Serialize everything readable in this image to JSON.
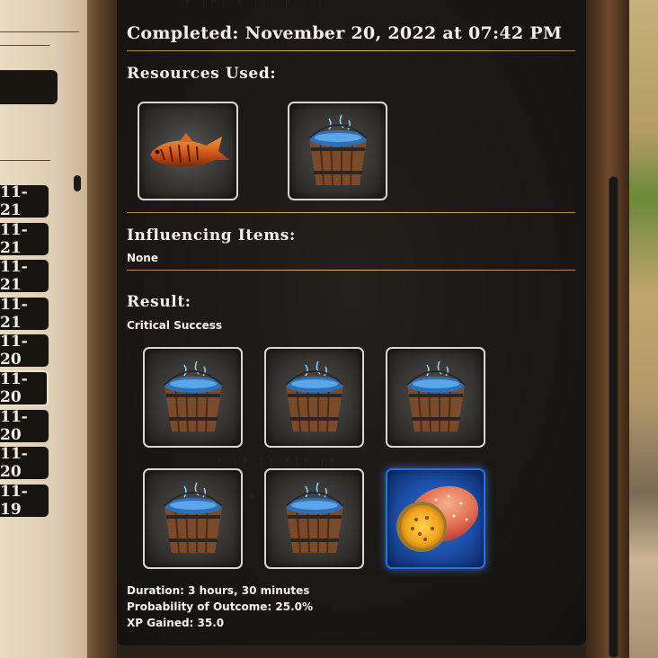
{
  "detail": {
    "completed": "Completed: November 20, 2022 at 07:42 PM",
    "resources_heading": "Resources Used:",
    "resources": [
      "grilled-fish-icon",
      "water-bucket-icon"
    ],
    "influencing_heading": "Influencing Items:",
    "influencing_value": "None",
    "result_heading": "Result:",
    "result_value": "Critical Success",
    "result_items": [
      "water-bucket-icon",
      "water-bucket-icon",
      "water-bucket-icon",
      "water-bucket-icon",
      "water-bucket-icon",
      "prickly-pear-fruit-icon"
    ],
    "result_highlighted_index": 5,
    "duration": "Duration: 3 hours, 30 minutes",
    "probability": "Probability of Outcome: 25.0%",
    "xp": "XP Gained: 35.0"
  },
  "history": {
    "dates": [
      "11-21",
      "11-21",
      "11-21",
      "11-21",
      "11-20",
      "11-20",
      "11-20",
      "11-20",
      "11-19"
    ],
    "selected_index": 5
  },
  "colors": {
    "panel_bg": "#1a1714",
    "gold_rule": "#d9b878",
    "text": "#f6f1e8",
    "highlight_blue": "#2f6ee0",
    "slot_border": "#d9d7d2"
  }
}
